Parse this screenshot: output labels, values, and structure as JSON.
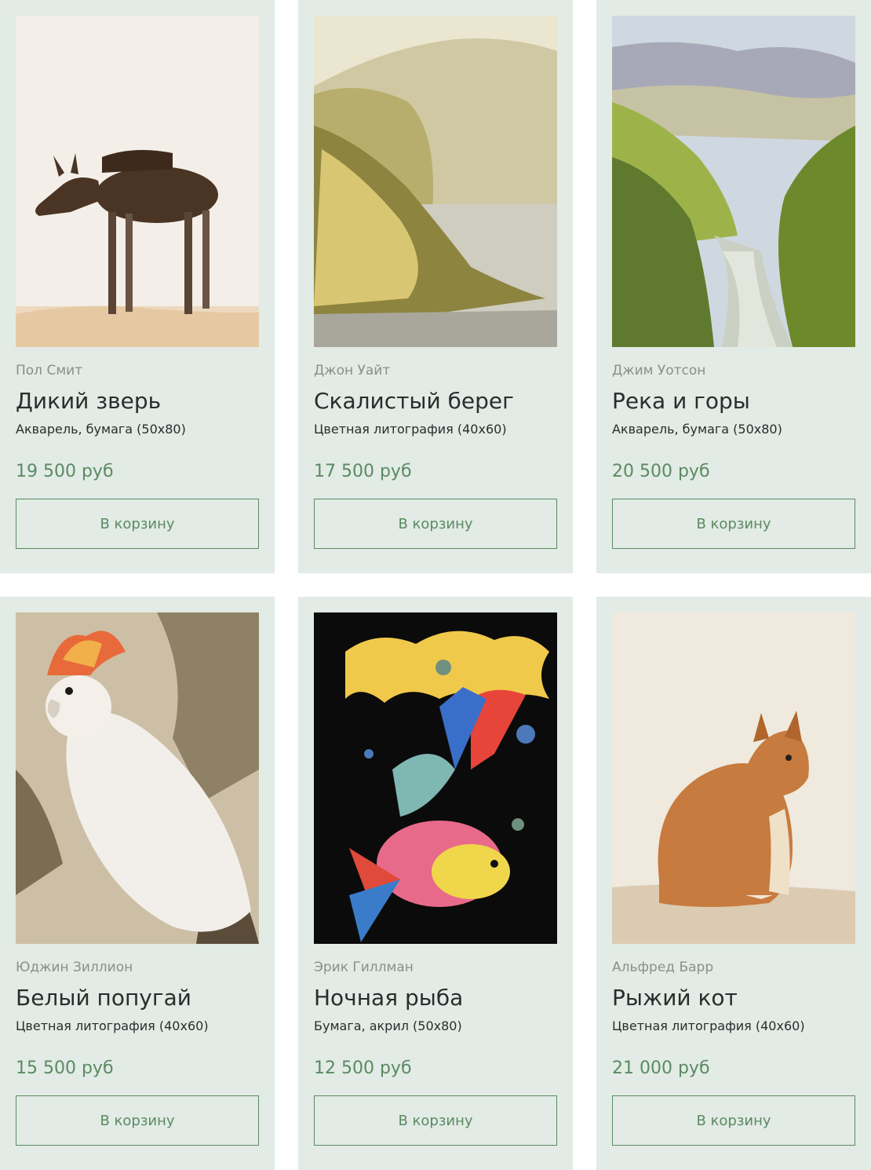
{
  "products": [
    {
      "artist": "Пол Смит",
      "title": "Дикий зверь",
      "medium": "Акварель, бумага (50x80)",
      "price": "19 500 руб",
      "button": "В корзину"
    },
    {
      "artist": "Джон Уайт",
      "title": "Скалистый берег",
      "medium": "Цветная литография (40x60)",
      "price": "17 500 руб",
      "button": "В корзину"
    },
    {
      "artist": "Джим Уотсон",
      "title": "Река и горы",
      "medium": "Акварель, бумага (50x80)",
      "price": "20 500 руб",
      "button": "В корзину"
    },
    {
      "artist": "Юджин Зиллион",
      "title": "Белый попугай",
      "medium": "Цветная литография (40x60)",
      "price": "15 500 руб",
      "button": "В корзину"
    },
    {
      "artist": "Эрик Гиллман",
      "title": "Ночная рыба",
      "medium": "Бумага, акрил (50x80)",
      "price": "12 500 руб",
      "button": "В корзину"
    },
    {
      "artist": "Альфред Барр",
      "title": "Рыжий кот",
      "medium": "Цветная литография (40x60)",
      "price": "21 000 руб",
      "button": "В корзину"
    }
  ],
  "colors": {
    "card_background": "#e2ebe5",
    "accent": "#5b8a62",
    "text": "#2a2d2c",
    "muted": "#8a8f8c"
  }
}
